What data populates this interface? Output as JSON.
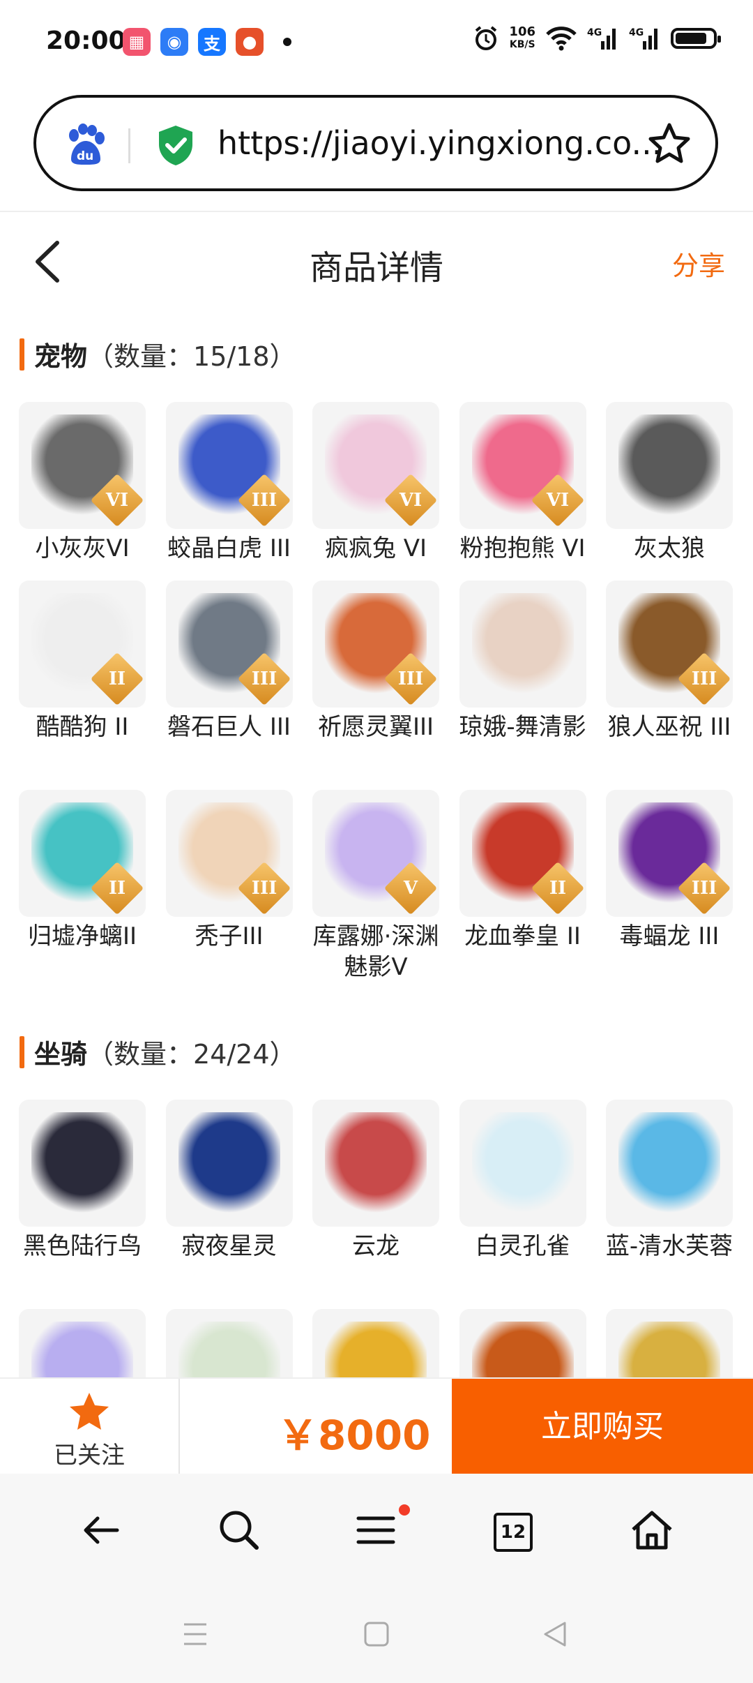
{
  "status": {
    "time": "20:00",
    "net_speed_top": "106",
    "net_speed_unit": "KB/S",
    "sig1": "4G",
    "sig2": "4G"
  },
  "browser": {
    "url": "https://jiaoyi.yingxiong.co..."
  },
  "header": {
    "title": "商品详情",
    "share": "分享"
  },
  "sections": [
    {
      "title": "宠物",
      "count": "（数量：15/18）"
    },
    {
      "title": "坐骑",
      "count": "（数量：24/24）"
    }
  ],
  "pets": [
    {
      "name": "小灰灰VI",
      "level": "VI",
      "color": "#6a6a6a"
    },
    {
      "name": "蛟晶白虎 III",
      "level": "III",
      "color": "#3d5bc9"
    },
    {
      "name": "疯疯兔 VI",
      "level": "VI",
      "color": "#f0c8dc"
    },
    {
      "name": "粉抱抱熊 VI",
      "level": "VI",
      "color": "#ef6a8c"
    },
    {
      "name": "灰太狼",
      "level": "",
      "color": "#5a5a5a"
    },
    {
      "name": "酷酷狗 II",
      "level": "II",
      "color": "#eeeeee"
    },
    {
      "name": "磐石巨人 III",
      "level": "III",
      "color": "#707a86"
    },
    {
      "name": "祈愿灵翼III",
      "level": "III",
      "color": "#d86a3a"
    },
    {
      "name": "琼娥-舞清影",
      "level": "",
      "color": "#e8d2c4"
    },
    {
      "name": "狼人巫祝 III",
      "level": "III",
      "color": "#8a5a2a"
    },
    {
      "name": "归墟净螭II",
      "level": "II",
      "color": "#46c2c4"
    },
    {
      "name": "秃子III",
      "level": "III",
      "color": "#f0d4b8"
    },
    {
      "name": "库露娜·深渊魅影V",
      "level": "V",
      "color": "#c8b4f0"
    },
    {
      "name": "龙血拳皇 II",
      "level": "II",
      "color": "#c83a2a"
    },
    {
      "name": "毒蝠龙 III",
      "level": "III",
      "color": "#6a2a9a"
    }
  ],
  "mounts": [
    {
      "name": "黑色陆行鸟",
      "color": "#2a2a3a"
    },
    {
      "name": "寂夜星灵",
      "color": "#1e3a8a"
    },
    {
      "name": "云龙",
      "color": "#c84a4a"
    },
    {
      "name": "白灵孔雀",
      "color": "#d8eef6"
    },
    {
      "name": "蓝-清水芙蓉",
      "color": "#5ab8e6"
    },
    {
      "name": "",
      "color": "#b8aef0"
    },
    {
      "name": "",
      "color": "#d8e6d0"
    },
    {
      "name": "",
      "color": "#e6b02a"
    },
    {
      "name": "",
      "color": "#c85a1a"
    },
    {
      "name": "",
      "color": "#d8b040"
    }
  ],
  "buy": {
    "follow_label": "已关注",
    "price": "￥8000",
    "buy_label": "立即购买"
  },
  "nav": {
    "tab_count": "12"
  }
}
